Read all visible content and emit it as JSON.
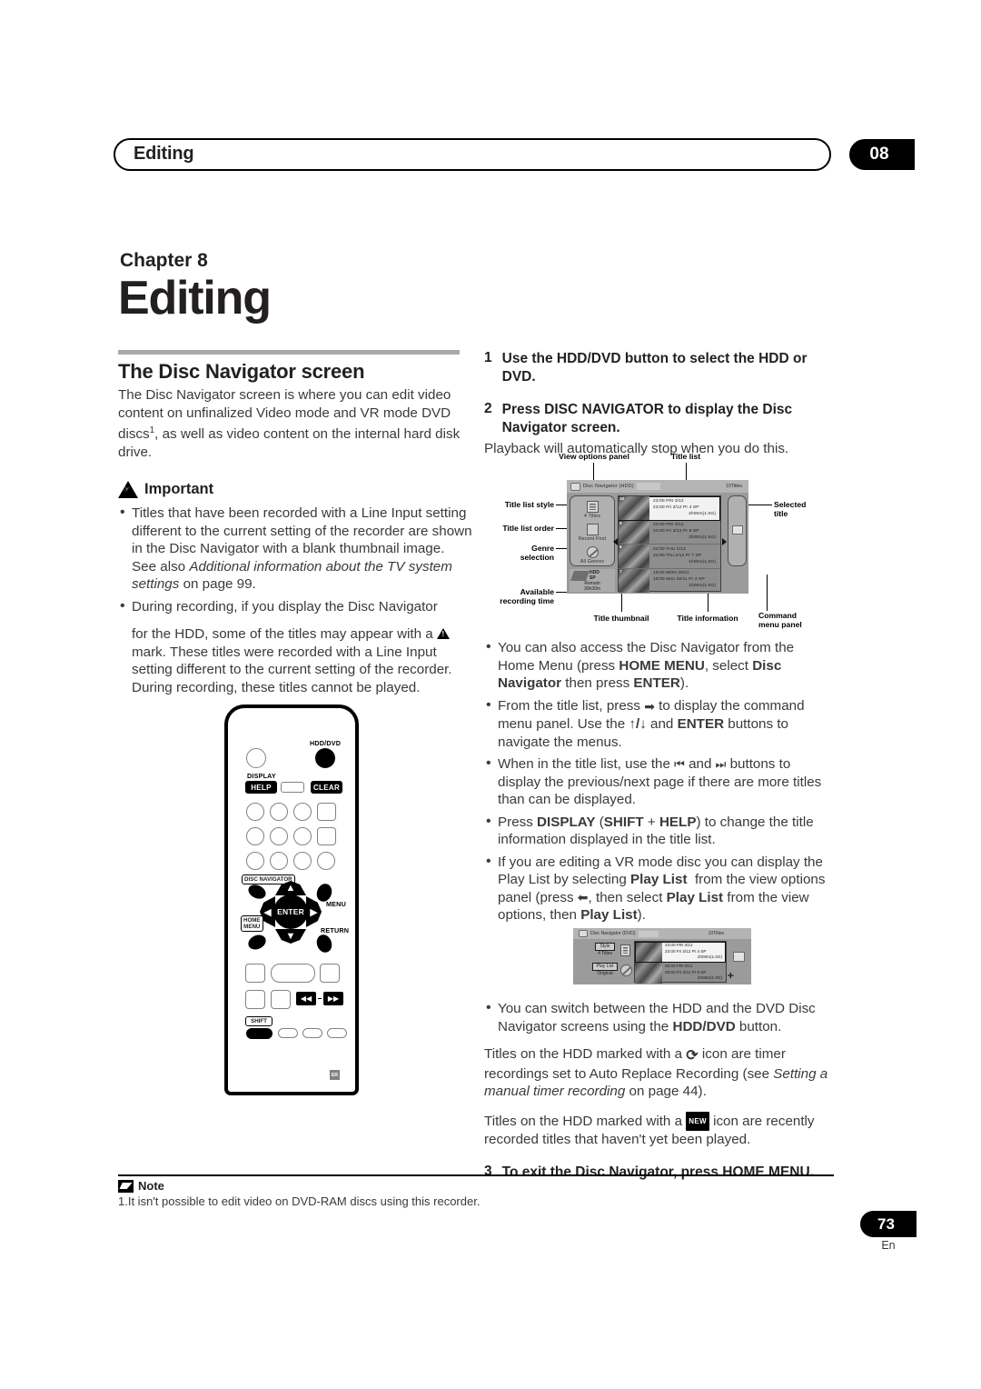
{
  "header": {
    "running_title": "Editing",
    "chapter_tab": "08"
  },
  "chapter": {
    "label": "Chapter 8",
    "name": "Editing"
  },
  "left_column": {
    "section_title": "The Disc Navigator screen",
    "intro_a": "The Disc Navigator screen is where you can edit video content on unfinalized Video mode and VR mode DVD discs",
    "intro_sup": "1",
    "intro_b": ", as well as video content on the internal hard disk drive.",
    "important_label": "Important",
    "bullets": [
      {
        "a": "Titles that have been recorded with a Line Input setting different to the current setting of the recorder are shown in the Disc Navigator with a blank thumbnail image. See also ",
        "i": "Additional information about the TV system settings",
        "b": " on page 99."
      },
      {
        "a": "During recording, if you display the Disc Navigator",
        "b2": "for the HDD, some of the titles may appear with a",
        "b3": "mark. These titles were recorded with a Line Input setting different to the current setting of the recorder. During recording, these titles cannot be played."
      }
    ]
  },
  "remote": {
    "labels": {
      "hdd_dvd": "HDD/DVD",
      "display": "DISPLAY",
      "help": "HELP",
      "clear": "CLEAR",
      "disc_navigator": "DISC NAVIGATOR",
      "menu": "MENU",
      "return": "RETURN",
      "home_menu_1": "HOME",
      "home_menu_2": "MENU",
      "enter": "ENTER",
      "shift": "SHIFT",
      "prev": "◀◀",
      "next": "▶▶",
      "corner_tag": "ER"
    }
  },
  "right_column": {
    "steps": [
      {
        "num": "1",
        "text": "Use the HDD/DVD button to select the HDD or DVD."
      },
      {
        "num": "2",
        "text": "Press DISC NAVIGATOR to display the Disc Navigator screen.",
        "sub": "Playback will automatically stop when you do this."
      },
      {
        "num": "3",
        "text": "To exit the Disc Navigator, press HOME MENU."
      }
    ],
    "bullets": [
      "You can also access the Disc Navigator from the Home Menu (press HOME MENU, select Disc Navigator then press ENTER).",
      "From the title list, press ➜ to display the command menu panel. Use the ↑/↓ and ENTER buttons to navigate the menus.",
      "When in the title list, use the ⏮ and ⏭ buttons to display the previous/next page if there are more titles than can be displayed.",
      "Press DISPLAY (SHIFT + HELP) to change the title information displayed in the title list.",
      "If you are editing a VR mode disc you can display the Play List by selecting Play List from the view options panel (press ←, then select Play List from the view options, then Play List).",
      "You can switch between the HDD and the DVD Disc Navigator screens using the HDD/DVD button."
    ],
    "para_timer_a": "Titles on the HDD marked with a",
    "para_timer_icon": "↺",
    "para_timer_b": "icon are timer recordings set to Auto Replace Recording (see ",
    "para_timer_ital": "Setting a manual timer recording",
    "para_timer_c": " on page 44).",
    "para_new_a": "Titles on the HDD marked with a",
    "para_new_icon": "NEW",
    "para_new_b": "icon are recently recorded titles that haven't yet been played."
  },
  "diagram_hdd": {
    "callouts": {
      "view_options_panel": "View options panel",
      "title_list": "Title list",
      "title_list_style": "Title list style",
      "title_list_order": "Title list order",
      "genre_selection_1": "Genre",
      "genre_selection_2": "selection",
      "available_1": "Available",
      "available_2": "recording time",
      "selected_title_1": "Selected",
      "selected_title_2": "title",
      "title_thumbnail": "Title thumbnail",
      "title_information": "Title information",
      "command_menu_1": "Command",
      "command_menu_2": "menu panel"
    },
    "screen": {
      "titlebar": "Disc  Navigator  (HDD)",
      "count": "10Titles",
      "view_options": [
        {
          "glyph": "list-style-icon",
          "label": "4  Titles"
        },
        {
          "glyph": "list-order-icon",
          "label": "Recent  First"
        },
        {
          "glyph": "genre-icon",
          "label": "All  Genres"
        }
      ],
      "remain_top_1": "HDD",
      "remain_top_2": "SP",
      "remain_bottom_1": "Remain",
      "remain_bottom_2": "30h30m",
      "rows": [
        {
          "num": "10",
          "line1": "23:00  FRI   3/12",
          "line2": "23:00   Fri   3/12   Pr 4   SP",
          "line3": "2h00m(1.0G)",
          "selected": true
        },
        {
          "num": "9",
          "line1": "20:00   FRI   3/12",
          "line2": "20:00     Fri   3/12   Pr 9   SP",
          "line3": "2h00m(1.0G)",
          "selected": false
        },
        {
          "num": "8",
          "line1": "22:00   THU   2/12",
          "line2": "22:00     Thu   2/12   Pr 7   SP",
          "line3": "1h00m(1.0G)",
          "selected": false
        },
        {
          "num": "7",
          "line1": "19:00   MON   29/11",
          "line2": "19:00     Mon   29/11   Pr 2   SP",
          "line3": "1h00m(1.0G)",
          "selected": false
        }
      ]
    }
  },
  "diagram_dvd": {
    "titlebar": "Disc  Navigator  (DVD)",
    "count": "10Titles",
    "options": [
      {
        "boxed": "Style",
        "label": "4 Titles"
      },
      {
        "boxed": "Play List",
        "label": "Original"
      }
    ],
    "rows": [
      {
        "line1": "23:00  FRI   3/12",
        "line2": "23:00   Fri   3/12   Pr 4   SP",
        "line3": "2h00m(1.0G)",
        "selected": true
      },
      {
        "line1": "20:00  FRI   3/12",
        "line2": "20:00   Fri   3/12   Pr 9   SP",
        "line3": "2h00m(1.0G)",
        "selected": false
      }
    ]
  },
  "footer": {
    "note_title": "Note",
    "note_text": "1.It isn't possible to edit video on DVD-RAM discs using this recorder.",
    "page_number": "73",
    "language": "En"
  }
}
